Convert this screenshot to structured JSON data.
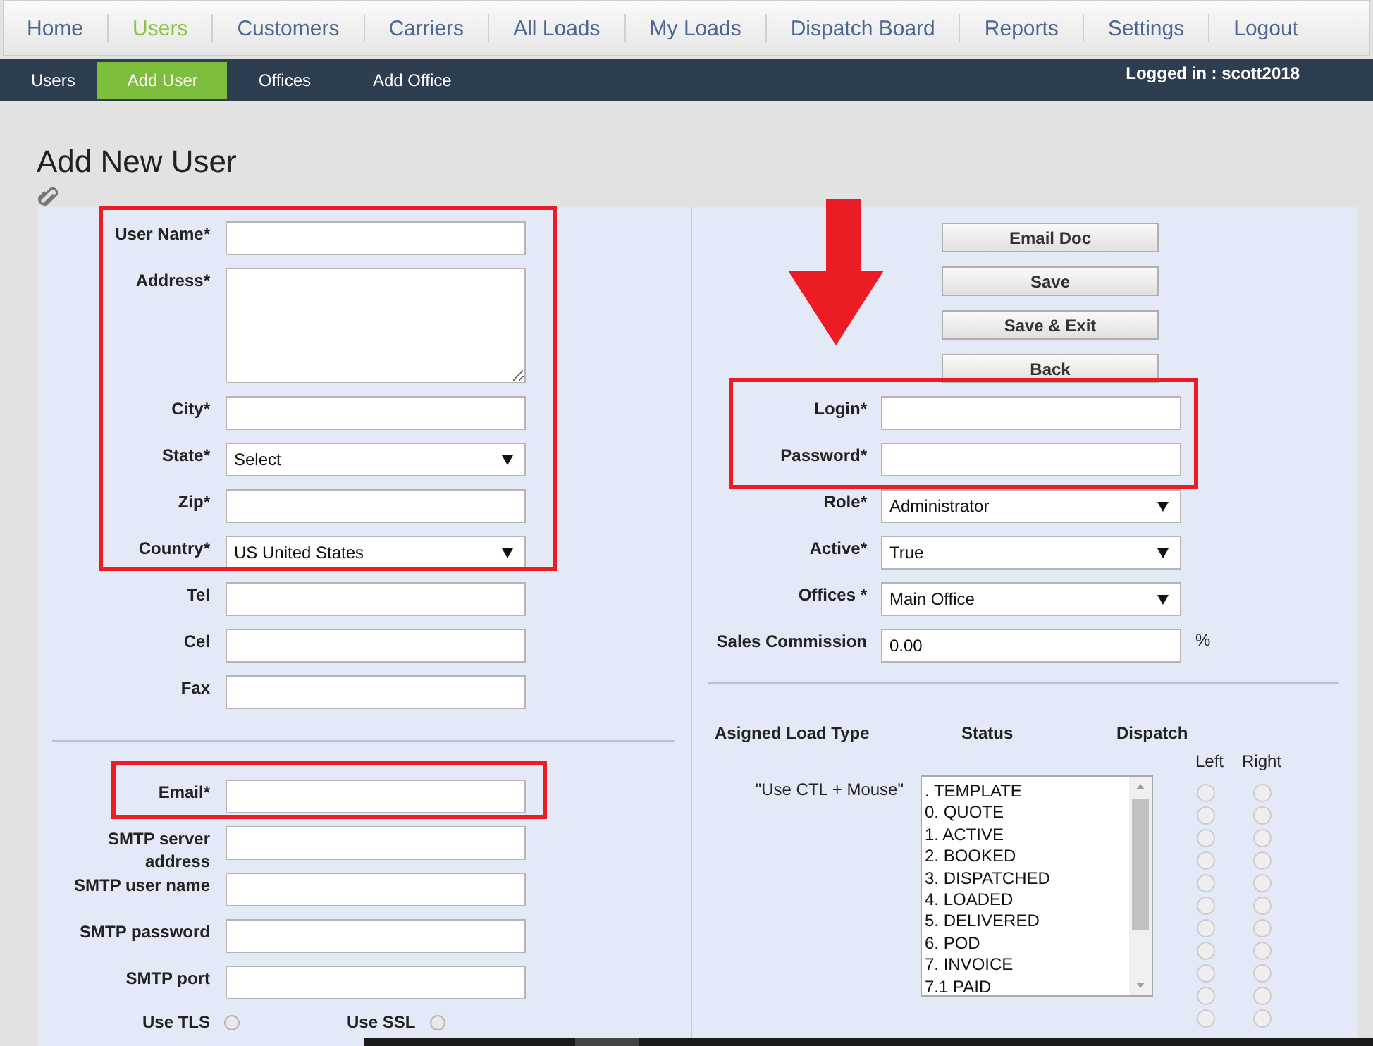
{
  "main_nav": [
    {
      "label": "Home",
      "selected": false
    },
    {
      "label": "Users",
      "selected": true
    },
    {
      "label": "Customers",
      "selected": false
    },
    {
      "label": "Carriers",
      "selected": false
    },
    {
      "label": "All Loads",
      "selected": false
    },
    {
      "label": "My Loads",
      "selected": false
    },
    {
      "label": "Dispatch Board",
      "selected": false
    },
    {
      "label": "Reports",
      "selected": false
    },
    {
      "label": "Settings",
      "selected": false
    },
    {
      "label": "Logout",
      "selected": false
    }
  ],
  "sub_nav": [
    {
      "label": "Users",
      "selected": false
    },
    {
      "label": "Add User",
      "selected": true
    },
    {
      "label": "Offices",
      "selected": false
    },
    {
      "label": "Add Office",
      "selected": false
    }
  ],
  "logged_in": "Logged in : scott2018",
  "page_title": "Add New User",
  "contact_fields": [
    {
      "label": "User Name*",
      "kind": "text"
    },
    {
      "label": "Address*",
      "kind": "textarea"
    },
    {
      "label": "City*",
      "kind": "text"
    },
    {
      "label": "State*",
      "kind": "select",
      "value": "Select"
    },
    {
      "label": "Zip*",
      "kind": "text"
    },
    {
      "label": "Country*",
      "kind": "select",
      "value": "US United States"
    },
    {
      "label": "Tel",
      "kind": "text"
    },
    {
      "label": "Cel",
      "kind": "text"
    },
    {
      "label": "Fax",
      "kind": "text"
    }
  ],
  "email_fields": [
    {
      "label": "Email*",
      "kind": "text"
    },
    {
      "label": "SMTP server address",
      "kind": "text"
    },
    {
      "label": "SMTP user name",
      "kind": "text"
    },
    {
      "label": "SMTP password",
      "kind": "text"
    },
    {
      "label": "SMTP port",
      "kind": "text"
    }
  ],
  "security_options": [
    {
      "label": "Use TLS",
      "checked": false
    },
    {
      "label": "Use SSL",
      "checked": false
    }
  ],
  "buttons": [
    "Email Doc",
    "Save",
    "Save & Exit",
    "Back"
  ],
  "account_fields": [
    {
      "label": "Login*",
      "kind": "text"
    },
    {
      "label": "Password*",
      "kind": "text"
    },
    {
      "label": "Role*",
      "kind": "select",
      "value": "Administrator"
    },
    {
      "label": "Active*",
      "kind": "select",
      "value": "True"
    },
    {
      "label": "Offices *",
      "kind": "select",
      "value": "Main Office"
    },
    {
      "label": "Sales Commission",
      "kind": "text",
      "value": "0.00",
      "suffix": "%"
    }
  ],
  "load_type": {
    "headings": [
      "Asigned Load Type",
      "Status",
      "Dispatch"
    ],
    "hint": "\"Use CTL + Mouse\"",
    "left_label": "Left",
    "right_label": "Right",
    "statuses": [
      {
        "label": ". TEMPLATE",
        "selected": false
      },
      {
        "label": "0. QUOTE",
        "selected": false
      },
      {
        "label": "1. ACTIVE",
        "selected": false
      },
      {
        "label": "2. BOOKED",
        "selected": false
      },
      {
        "label": "3. DISPATCHED",
        "selected": false
      },
      {
        "label": "4. LOADED",
        "selected": false
      },
      {
        "label": "5. DELIVERED",
        "selected": false
      },
      {
        "label": "6. POD",
        "selected": false
      },
      {
        "label": "7. INVOICE",
        "selected": false
      },
      {
        "label": "7.1 PAID",
        "selected": false
      }
    ],
    "dispatch": [
      {
        "left": false,
        "right": false
      },
      {
        "left": false,
        "right": false
      },
      {
        "left": false,
        "right": false
      },
      {
        "left": false,
        "right": false
      },
      {
        "left": false,
        "right": false
      },
      {
        "left": false,
        "right": false
      },
      {
        "left": false,
        "right": false
      },
      {
        "left": false,
        "right": false
      },
      {
        "left": false,
        "right": false
      },
      {
        "left": false,
        "right": false
      },
      {
        "left": false,
        "right": false
      }
    ]
  }
}
